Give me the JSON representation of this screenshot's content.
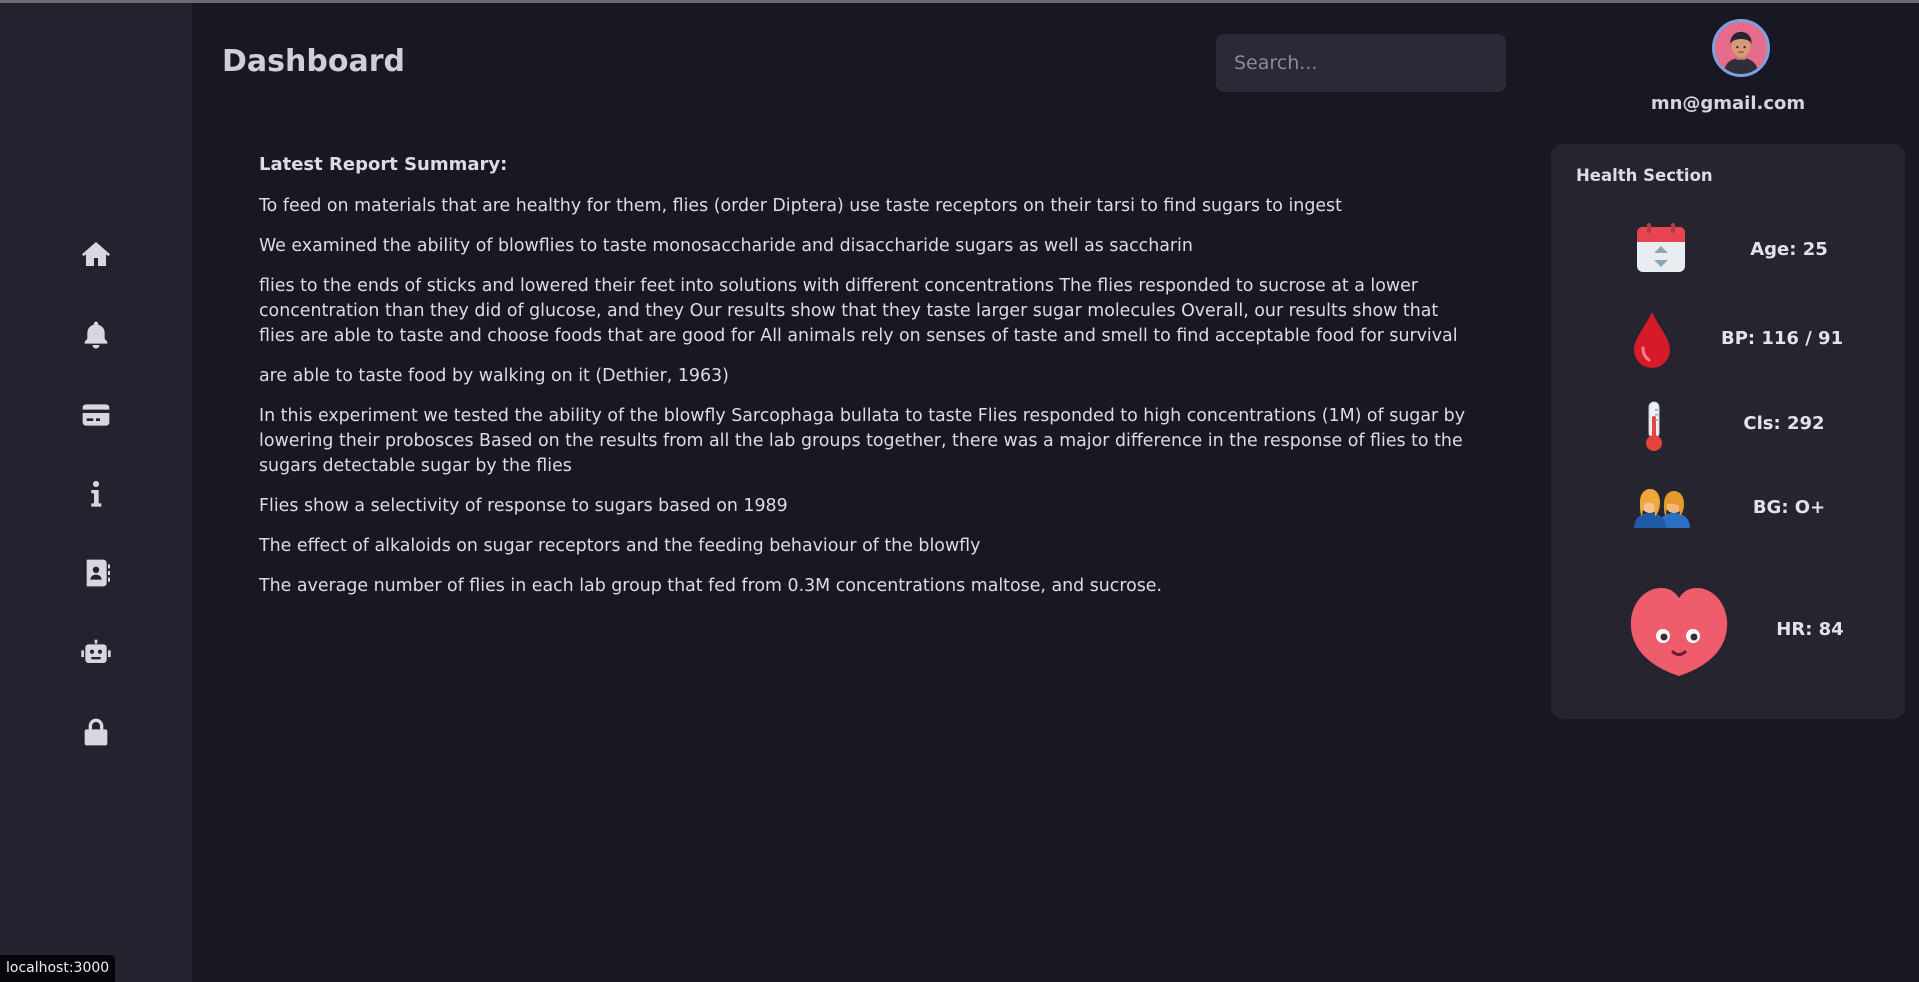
{
  "header": {
    "title": "Dashboard",
    "search_placeholder": "Search..."
  },
  "user": {
    "email": "mn@gmail.com"
  },
  "sidebar": {
    "items": [
      {
        "icon": "home-icon"
      },
      {
        "icon": "bell-icon"
      },
      {
        "icon": "card-icon"
      },
      {
        "icon": "info-icon"
      },
      {
        "icon": "contact-book-icon"
      },
      {
        "icon": "robot-icon"
      },
      {
        "icon": "lock-icon"
      }
    ]
  },
  "report": {
    "heading": "Latest Report Summary:",
    "paragraphs": [
      "To feed on materials that are healthy for them, flies (order Diptera) use taste receptors on their tarsi to find sugars to ingest",
      "We examined the ability of blowflies to taste monosaccharide and disaccharide sugars as well as saccharin",
      "flies to the ends of sticks and lowered their feet into solutions with different concentrations The flies responded to sucrose at a lower concentration than they did of glucose, and they Our results show that they taste larger sugar molecules Overall, our results show that flies are able to taste and choose foods that are good for All animals rely on senses of taste and smell to find acceptable food for survival",
      "are able to taste food by walking on it (Dethier, 1963)",
      "In this experiment we tested the ability of the blowfly Sarcophaga bullata to taste Flies responded to high concentrations (1M) of sugar by lowering their probosces Based on the results from all the lab groups together, there was a major difference in the response of flies to the sugars detectable sugar by the flies",
      "Flies show a selectivity of response to sugars based on 1989",
      "The effect of alkaloids on sugar receptors and the feeding behaviour of the blowfly",
      "The average number of flies in each lab group that fed from 0.3M concentrations maltose, and sucrose."
    ]
  },
  "health": {
    "title": "Health Section",
    "age": "Age: 25",
    "bp": "BP: 116 / 91",
    "cls": "Cls: 292",
    "bg": "BG: O+",
    "hr": "HR: 84"
  },
  "status_bar": {
    "url": "localhost:3000"
  },
  "colors": {
    "background": "#181823",
    "sidebar": "#23222f",
    "panel": "#25242f",
    "text": "#dcdce6"
  }
}
